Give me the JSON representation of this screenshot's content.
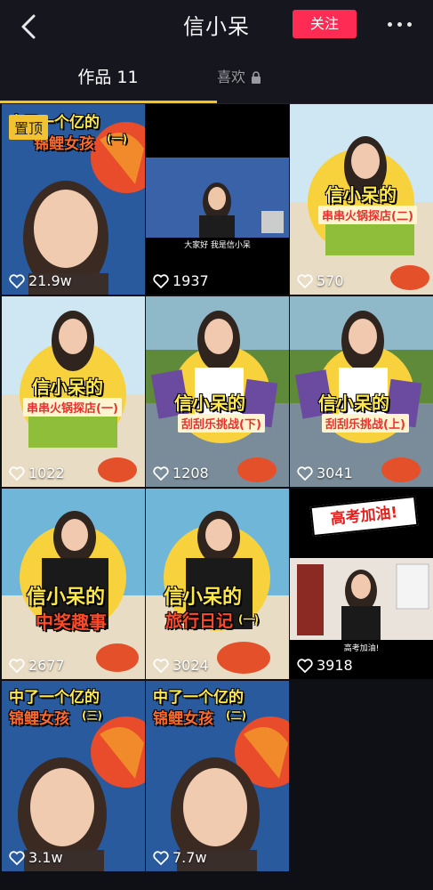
{
  "header": {
    "title": "信小呆",
    "follow_label": "关注"
  },
  "tabs": [
    {
      "label": "作品 11"
    },
    {
      "label": "喜欢"
    }
  ],
  "pinned_label": "置顶",
  "videos": [
    {
      "likes": "21.9w",
      "cover_title": "中了一个亿的",
      "cover_line2": "锦鲤女孩",
      "cover_sub": "(一)"
    },
    {
      "likes": "1937",
      "caption": "大家好 我是信小呆"
    },
    {
      "likes": "570",
      "cover_title": "信小呆的",
      "cover_sub": "串串火锅探店(二)"
    },
    {
      "likes": "1022",
      "cover_title": "信小呆的",
      "cover_sub": "串串火锅探店(一)"
    },
    {
      "likes": "1208",
      "cover_title": "信小呆的",
      "cover_sub": "刮刮乐挑战(下)"
    },
    {
      "likes": "3041",
      "cover_title": "信小呆的",
      "cover_sub": "刮刮乐挑战(上)"
    },
    {
      "likes": "2677",
      "cover_title": "信小呆的",
      "cover_line2": "中奖趣事"
    },
    {
      "likes": "3024",
      "cover_title": "信小呆的",
      "cover_line2": "旅行日记",
      "cover_sub": "(一)"
    },
    {
      "likes": "3918",
      "banner": "高考加油!",
      "caption": "高考加油!"
    },
    {
      "likes": "3.1w",
      "cover_title": "中了一个亿的",
      "cover_line2": "锦鲤女孩",
      "cover_sub": "(三)"
    },
    {
      "likes": "7.7w",
      "cover_title": "中了一个亿的",
      "cover_line2": "锦鲤女孩",
      "cover_sub": "(二)"
    }
  ],
  "colors": {
    "accent": "#fe2c55",
    "tab_indicator": "#f5c518",
    "background": "#0f0f16"
  }
}
